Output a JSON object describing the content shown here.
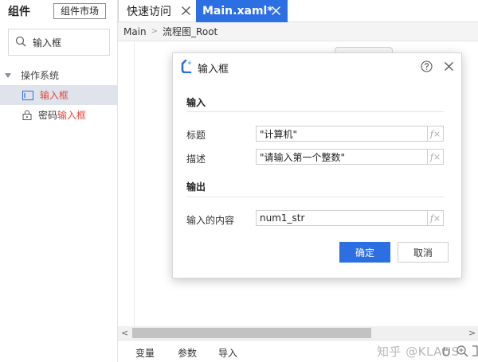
{
  "left_panel": {
    "title": "组件",
    "market_button": "组件市场",
    "search_value": "输入框",
    "category": "操作系统",
    "items": [
      {
        "label": "输入框",
        "selected": true
      },
      {
        "label_prefix": "密码",
        "label_highlight": "输入框",
        "selected": false
      }
    ]
  },
  "tabs": [
    {
      "label": "快速访问",
      "active": false
    },
    {
      "label": "Main.xaml*",
      "active": true
    }
  ],
  "breadcrumb": [
    "Main",
    "流程图_Root"
  ],
  "bottom_tabs": [
    "变量",
    "参数",
    "导入"
  ],
  "watermark": "知乎 @KLAUS",
  "dialog": {
    "title": "输入框",
    "input_section": "输入",
    "output_section": "输出",
    "fields": {
      "title_label": "标题",
      "title_value": "\"计算机\"",
      "desc_label": "描述",
      "desc_value": "\"请输入第一个整数\"",
      "output_label": "输入的内容",
      "output_value": "num1_str"
    },
    "fx_label": "f×",
    "ok_label": "确定",
    "cancel_label": "取消"
  },
  "colors": {
    "accent": "#2c6fe2",
    "highlight": "#e0453a"
  }
}
